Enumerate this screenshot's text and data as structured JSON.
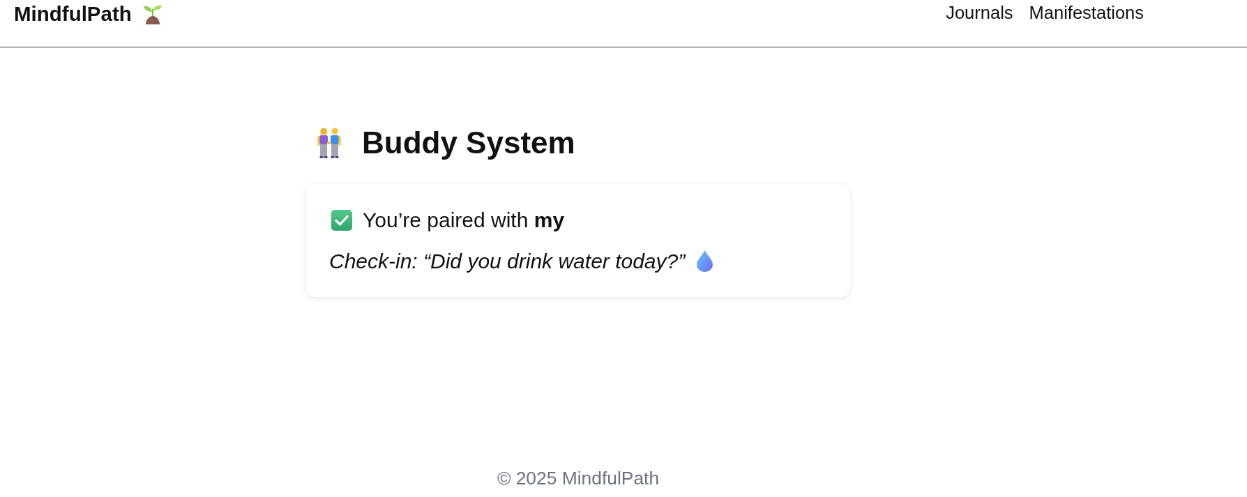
{
  "header": {
    "logo": "MindfulPath",
    "nav": [
      {
        "label": "Journals"
      },
      {
        "label": "Manifestations"
      }
    ]
  },
  "page": {
    "title": "Buddy System"
  },
  "card": {
    "paired_text": "You’re paired with **my**",
    "checkin": "Check-in: “Did you drink water today?”"
  },
  "footer": {
    "copyright": "© 2025 MindfulPath"
  }
}
